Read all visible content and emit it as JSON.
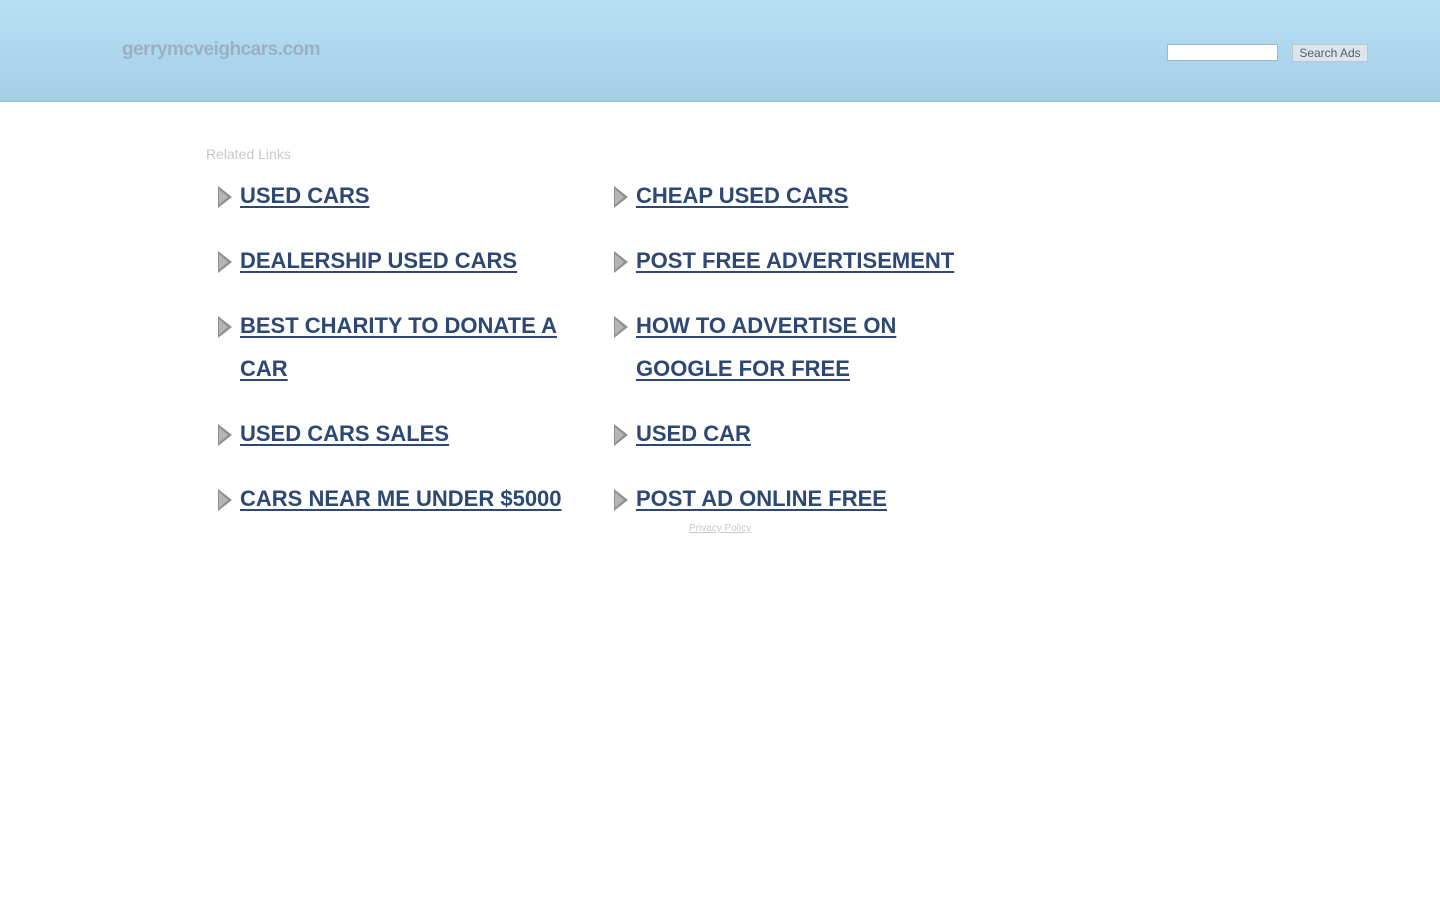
{
  "header": {
    "site_name": "gerrymcveighcars.com",
    "search": {
      "placeholder": "",
      "value": "",
      "button_label": "Search Ads"
    }
  },
  "main": {
    "related_title": "Related Links",
    "left_links": [
      "USED CARS",
      "DEALERSHIP USED CARS",
      "BEST CHARITY TO DONATE A CAR",
      "USED CARS SALES",
      "CARS NEAR ME UNDER $5000"
    ],
    "right_links": [
      "CHEAP USED CARS",
      "POST FREE ADVERTISEMENT",
      "HOW TO ADVERTISE ON GOOGLE FOR FREE",
      "USED CAR",
      "POST AD ONLINE FREE"
    ]
  },
  "footer": {
    "privacy_label": "Privacy Policy"
  },
  "colors": {
    "header_bg": "#b8e0f4",
    "link": "#2d4873",
    "muted": "#c8c8c8"
  }
}
